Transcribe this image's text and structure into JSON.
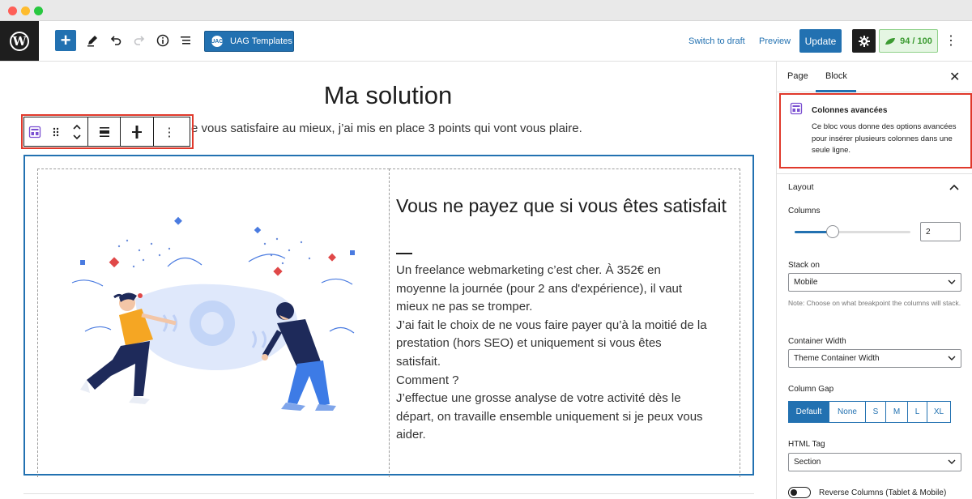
{
  "toolbar": {
    "uag_badge": "UAG",
    "uag_templates_label": "UAG Templates",
    "switch_to_draft_label": "Switch to draft",
    "preview_label": "Preview",
    "update_label": "Update",
    "score_label": "94 / 100"
  },
  "editor": {
    "page_title": "Ma solution",
    "intro_text": "e vous satisfaire au mieux, j’ai mis en place 3 points qui vont vous plaire.",
    "column_heading": "Vous ne payez que si vous êtes satisfait",
    "column_paragraph_lines": [
      "Un freelance webmarketing c’est cher. À 352€ en",
      "moyenne la journée (pour 2 ans d'expérience), il vaut",
      "mieux ne pas se tromper.",
      "J’ai fait le choix de ne vous faire payer qu’à la moitié de la",
      "prestation (hors SEO) et uniquement si vous êtes",
      "satisfait.",
      "Comment ?",
      "J’effectue une grosse analyse de votre activité dès le",
      "départ, on travaille ensemble uniquement si je peux vous",
      "aider."
    ]
  },
  "sidebar": {
    "tabs": [
      "Page",
      "Block"
    ],
    "active_tab": "Block",
    "block_card": {
      "title": "Colonnes avancées",
      "description": "Ce bloc vous donne des options avancées pour insérer plusieurs colonnes dans une seule ligne."
    },
    "layout": {
      "section_title": "Layout",
      "columns_label": "Columns",
      "columns_value": "2",
      "columns_slider_fraction": 0.33,
      "stack_on_label": "Stack on",
      "stack_on_value": "Mobile",
      "stack_on_hint": "Note: Choose on what breakpoint the columns will stack.",
      "container_width_label": "Container Width",
      "container_width_value": "Theme Container Width",
      "column_gap_label": "Column Gap",
      "column_gap_options": [
        "Default",
        "None",
        "S",
        "M",
        "L",
        "XL"
      ],
      "column_gap_selected": "Default",
      "html_tag_label": "HTML Tag",
      "html_tag_value": "Section",
      "reverse_columns_label": "Reverse Columns (Tablet & Mobile)"
    }
  },
  "colors": {
    "accent": "#2271b1",
    "highlight_frame": "#e0392b",
    "score_green": "#3c9b32",
    "dark": "#1e1e1e"
  },
  "icons": {
    "wp_logo": "wordpress-logo-icon",
    "add": "plus-icon",
    "edit": "pencil-icon",
    "undo": "undo-icon",
    "redo": "redo-icon",
    "info": "info-icon",
    "list_view": "list-view-icon",
    "settings": "gear-icon",
    "score": "leaf-icon",
    "more": "vertical-dots-icon"
  }
}
